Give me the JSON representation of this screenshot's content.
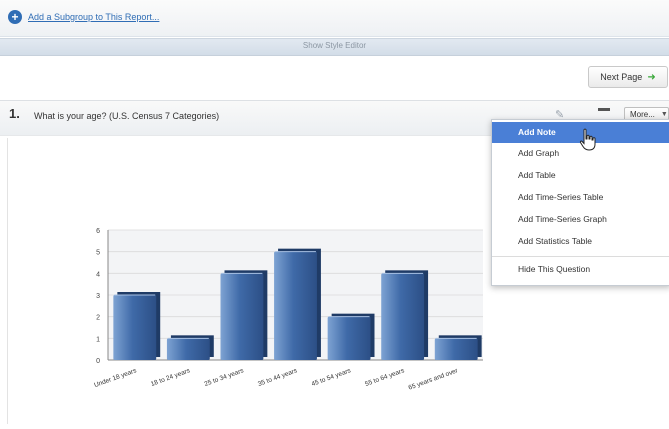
{
  "top": {
    "add_subgroup": "Add a Subgroup to This Report..."
  },
  "style_editor": {
    "label": "Show Style Editor"
  },
  "nav": {
    "next_page": "Next Page"
  },
  "question": {
    "number": "1.",
    "text": "What is your age? (U.S. Census 7 Categories)",
    "more_label": "More..."
  },
  "menu": {
    "items": [
      "Add Note",
      "Add Graph",
      "Add Table",
      "Add Time-Series Table",
      "Add Time-Series Graph",
      "Add Statistics Table"
    ],
    "hide": "Hide This Question",
    "active_index": 0
  },
  "colors": {
    "bar": "#3f6aa8",
    "bar_light": "#7ea3d3",
    "menu_active": "#4a7fd6"
  },
  "chart_data": {
    "type": "bar",
    "categories": [
      "Under 18 years",
      "18 to 24 years",
      "25 to 34 years",
      "35 to 44 years",
      "45 to 54 years",
      "55 to 64 years",
      "65 years and over"
    ],
    "values": [
      3,
      1,
      4,
      5,
      2,
      4,
      1
    ],
    "ylim": [
      0,
      6
    ],
    "yticks": [
      "0",
      "1",
      "2",
      "3",
      "4",
      "5",
      "6"
    ],
    "grid": true
  }
}
